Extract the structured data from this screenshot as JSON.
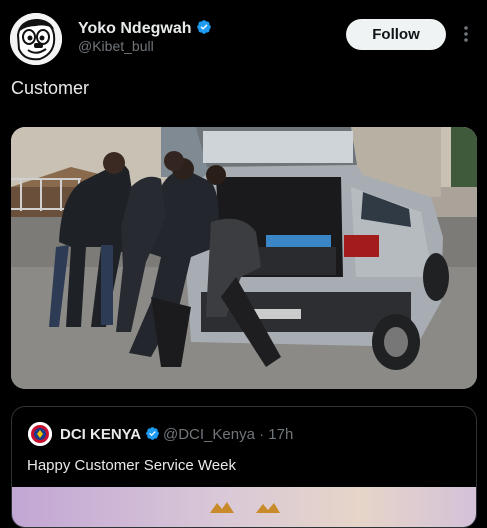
{
  "post": {
    "author_name": "Yoko Ndegwah",
    "author_handle": "@Kibet_bull",
    "follow_label": "Follow",
    "text": "Customer"
  },
  "quoted_post": {
    "author_name": "DCI KENYA",
    "author_handle": "@DCI_Kenya",
    "separator": "·",
    "time": "17h",
    "text": "Happy Customer Service Week"
  },
  "colors": {
    "background": "#000000",
    "verified_blue": "#1d9bf0",
    "secondary_text": "#71767b"
  },
  "icons": {
    "verified": "verified-badge-icon",
    "more": "more-options-icon"
  }
}
